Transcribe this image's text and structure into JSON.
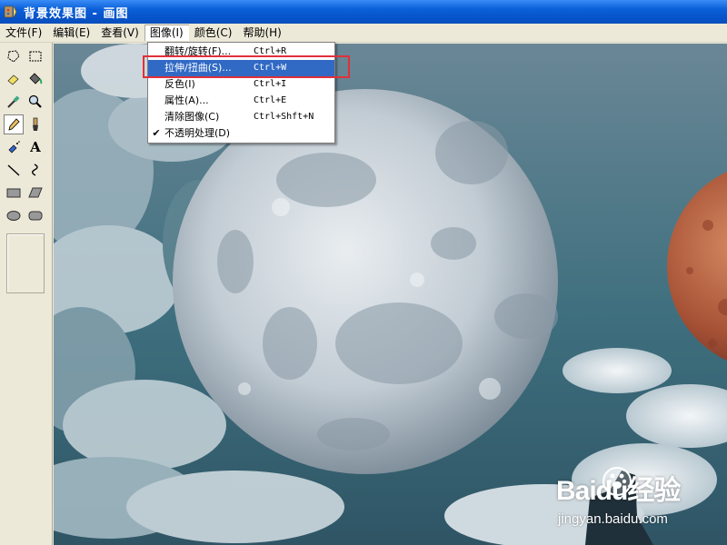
{
  "window": {
    "title": "背景效果图 - 画图"
  },
  "menubar": [
    {
      "label": "文件(F)"
    },
    {
      "label": "编辑(E)"
    },
    {
      "label": "查看(V)"
    },
    {
      "label": "图像(I)"
    },
    {
      "label": "颜色(C)"
    },
    {
      "label": "帮助(H)"
    }
  ],
  "image_menu": [
    {
      "label": "翻转/旋转(F)...",
      "shortcut": "Ctrl+R",
      "checked": false,
      "highlighted": false
    },
    {
      "label": "拉伸/扭曲(S)...",
      "shortcut": "Ctrl+W",
      "checked": false,
      "highlighted": true
    },
    {
      "label": "反色(I)",
      "shortcut": "Ctrl+I",
      "checked": false,
      "highlighted": false
    },
    {
      "label": "属性(A)...",
      "shortcut": "Ctrl+E",
      "checked": false,
      "highlighted": false
    },
    {
      "label": "清除图像(C)",
      "shortcut": "Ctrl+Shft+N",
      "checked": false,
      "highlighted": false
    },
    {
      "label": "不透明处理(D)",
      "shortcut": "",
      "checked": true,
      "highlighted": false
    }
  ],
  "toolbox": [
    {
      "icon": "free-select-icon"
    },
    {
      "icon": "rect-select-icon"
    },
    {
      "icon": "eraser-icon"
    },
    {
      "icon": "fill-bucket-icon"
    },
    {
      "icon": "eyedropper-icon"
    },
    {
      "icon": "magnifier-icon"
    },
    {
      "icon": "pencil-icon",
      "selected": true
    },
    {
      "icon": "brush-icon"
    },
    {
      "icon": "airbrush-icon"
    },
    {
      "icon": "text-icon",
      "glyph": "A"
    },
    {
      "icon": "line-icon"
    },
    {
      "icon": "curve-icon"
    },
    {
      "icon": "rectangle-icon"
    },
    {
      "icon": "polygon-icon"
    },
    {
      "icon": "ellipse-icon"
    },
    {
      "icon": "rounded-rect-icon"
    }
  ],
  "watermark": {
    "brand": "Baidu经验",
    "url": "jingyan.baidu.com"
  },
  "colors": {
    "highlight": "#316ac5",
    "annotation": "#e0303a",
    "titlebar": "#0a5fd8"
  }
}
